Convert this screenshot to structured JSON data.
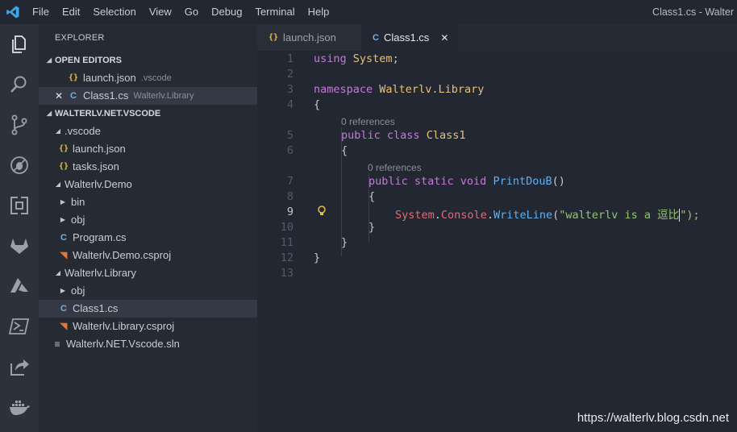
{
  "menu": [
    "File",
    "Edit",
    "Selection",
    "View",
    "Go",
    "Debug",
    "Terminal",
    "Help"
  ],
  "window_title": "Class1.cs - Walter",
  "activity_icons": [
    "explorer-icon",
    "search-icon",
    "source-control-icon",
    "debug-icon",
    "extensions-icon",
    "gitlab-icon",
    "azure-icon",
    "powershell-icon",
    "live-share-icon",
    "docker-icon"
  ],
  "explorer": {
    "title": "EXPLORER",
    "open_editors_title": "OPEN EDITORS",
    "open_editors": [
      {
        "name": "launch.json",
        "desc": ".vscode"
      },
      {
        "name": "Class1.cs",
        "desc": "Walterlv.Library"
      }
    ],
    "workspace_title": "WALTERLV.NET.VSCODE",
    "tree": [
      {
        "name": ".vscode"
      },
      {
        "name": "launch.json"
      },
      {
        "name": "tasks.json"
      },
      {
        "name": "Walterlv.Demo"
      },
      {
        "name": "bin"
      },
      {
        "name": "obj"
      },
      {
        "name": "Program.cs"
      },
      {
        "name": "Walterlv.Demo.csproj"
      },
      {
        "name": "Walterlv.Library"
      },
      {
        "name": "obj"
      },
      {
        "name": "Class1.cs"
      },
      {
        "name": "Walterlv.Library.csproj"
      },
      {
        "name": "Walterlv.NET.Vscode.sln"
      }
    ]
  },
  "tabs": [
    {
      "label": "launch.json"
    },
    {
      "label": "Class1.cs"
    }
  ],
  "editor": {
    "line_numbers": [
      "1",
      "2",
      "3",
      "4",
      "5",
      "6",
      "7",
      "8",
      "9",
      "10",
      "11",
      "12",
      "13"
    ],
    "code": {
      "l1_kw": "using",
      "l1_ty": "System",
      "l1_end": ";",
      "l3_kw": "namespace",
      "l3_ty": "Walterlv.Library",
      "l4": "{",
      "lens1": "0 references",
      "l5_kw": "public class",
      "l5_ty": "Class1",
      "l6": "{",
      "lens2": "0 references",
      "l7_kw": "public static void",
      "l7_fn": "PrintDouB",
      "l7_end": "()",
      "l8": "{",
      "l9_ty": "System",
      "l9_dot1": ".",
      "l9_pr": "Console",
      "l9_dot2": ".",
      "l9_fn": "WriteLine",
      "l9_open": "(",
      "l9_str": "\"walterlv is a 逗比",
      "l9_close": "\");",
      "l10": "}",
      "l11": "}",
      "l12": "}"
    }
  },
  "watermark": "https://walterlv.blog.csdn.net",
  "colors": {
    "accent": "#3fa6e8",
    "keyword": "#c678dd",
    "type": "#e5c07b",
    "function": "#61afef",
    "string": "#98c379"
  }
}
